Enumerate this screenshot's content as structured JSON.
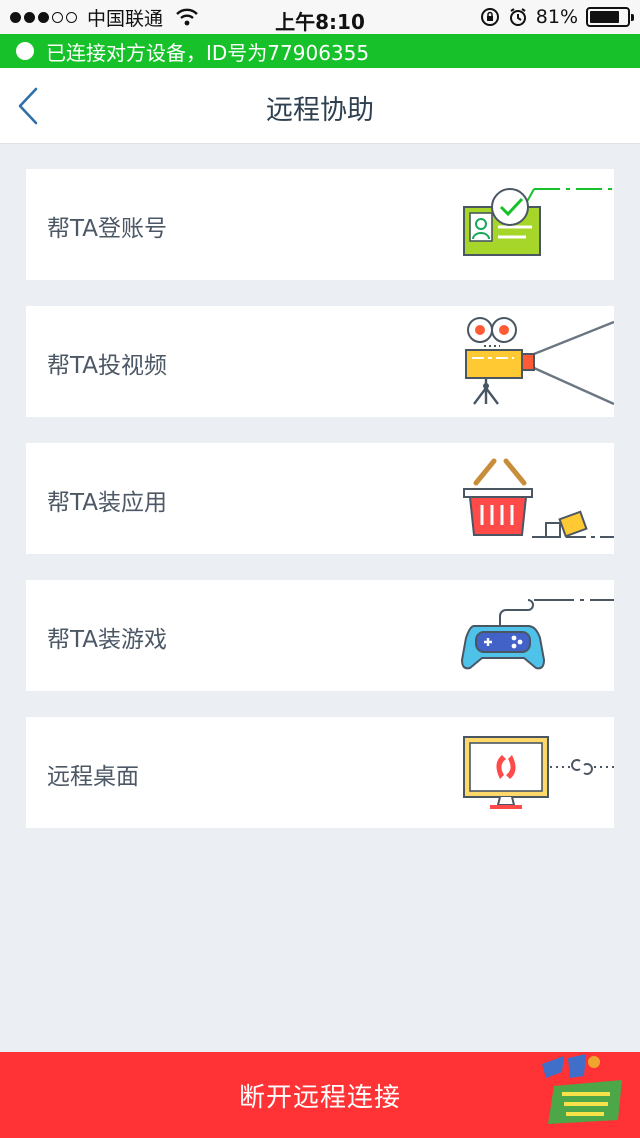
{
  "status_bar": {
    "carrier": "中国联通",
    "time": "上午8:10",
    "battery_percent": "81%",
    "battery_level": 0.81
  },
  "connection_banner": {
    "text": "已连接对方设备，ID号为77906355",
    "color": "#17c12a"
  },
  "nav": {
    "title": "远程协助"
  },
  "cards": [
    {
      "label": "帮TA登账号",
      "icon": "account-card-icon"
    },
    {
      "label": "帮TA投视频",
      "icon": "projector-icon"
    },
    {
      "label": "帮TA装应用",
      "icon": "basket-icon"
    },
    {
      "label": "帮TA装游戏",
      "icon": "gamepad-icon"
    },
    {
      "label": "远程桌面",
      "icon": "monitor-icon"
    }
  ],
  "bottom_button": {
    "label": "断开远程连接",
    "color": "#ff3235"
  }
}
